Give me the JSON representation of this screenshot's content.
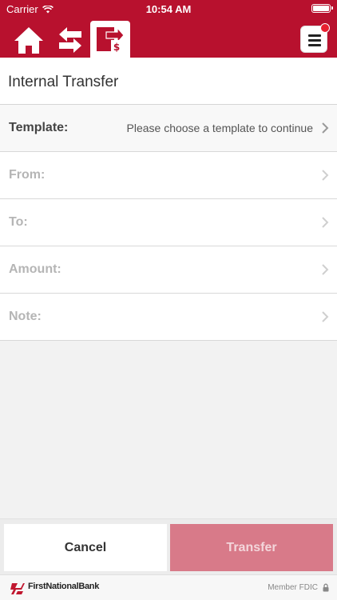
{
  "status_bar": {
    "carrier": "Carrier",
    "time": "10:54 AM"
  },
  "nav": {
    "icons": [
      "home-icon",
      "transfer-arrows-icon",
      "transfer-dollar-icon",
      "menu-icon"
    ],
    "active_tab": "transfer-dollar-icon",
    "notification_dot_color": "#e8202f"
  },
  "page": {
    "title": "Internal Transfer"
  },
  "form": {
    "rows": [
      {
        "label": "Template:",
        "value": "Please choose a template to continue"
      },
      {
        "label": "From:",
        "value": ""
      },
      {
        "label": "To:",
        "value": ""
      },
      {
        "label": "Amount:",
        "value": ""
      },
      {
        "label": "Note:",
        "value": ""
      }
    ]
  },
  "actions": {
    "cancel_label": "Cancel",
    "transfer_label": "Transfer"
  },
  "footer": {
    "brand": "FirstNationalBank",
    "member": "Member FDIC"
  },
  "colors": {
    "brand_red": "#b8112e",
    "transfer_disabled": "#d87a89"
  }
}
